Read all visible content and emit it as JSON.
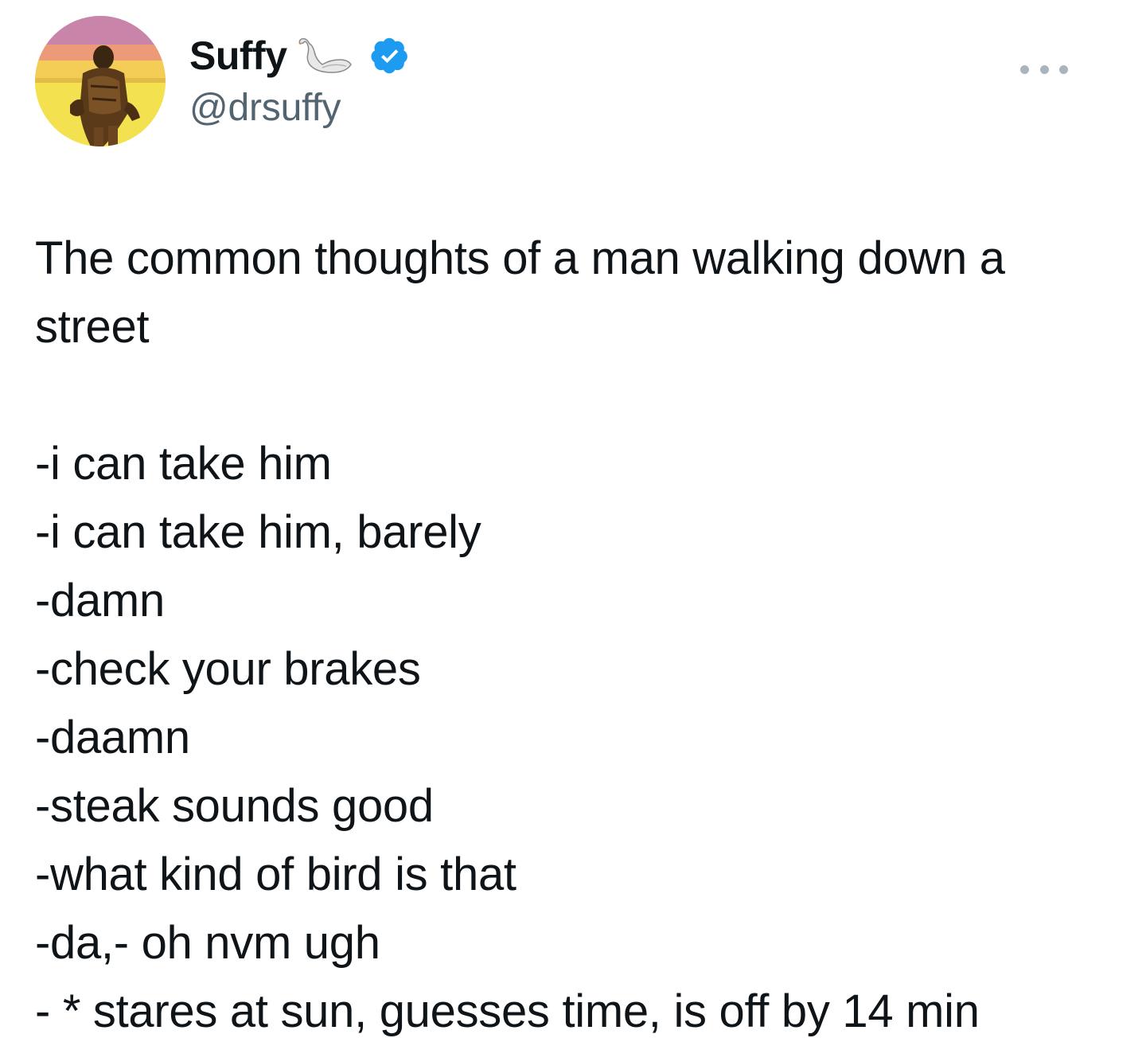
{
  "author": {
    "display_name": "Suffy",
    "handle": "@drsuffy",
    "name_emoji_icon": "swan-icon",
    "verified_icon": "verified-badge-icon",
    "verified_color": "#1d9bf0"
  },
  "more_icon": "more-options-icon",
  "tweet": {
    "intro": "The common thoughts of a man walking down a street",
    "lines": [
      "-i can take him",
      "-i can take him, barely",
      "-damn",
      "-check your brakes",
      "-daamn",
      "-steak sounds good",
      "-what kind of bird is that",
      "-da,- oh nvm ugh",
      "- * stares at sun, guesses time, is off by 14 min"
    ]
  },
  "colors": {
    "text_primary": "#0f1419",
    "text_secondary": "#536471",
    "background": "#ffffff"
  }
}
